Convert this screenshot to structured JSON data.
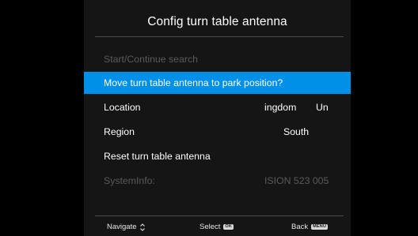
{
  "dialog": {
    "title": "Config turn table antenna"
  },
  "menu": {
    "items": [
      {
        "label": "Start/Continue search",
        "state": "disabled"
      },
      {
        "label": "Move turn table antenna to park position?",
        "state": "selected"
      },
      {
        "label": "Location",
        "value_a": "ingdom",
        "value_b": "Un",
        "state": "normal"
      },
      {
        "label": "Region",
        "value_a": "South",
        "state": "normal"
      },
      {
        "label": "Reset turn table antenna",
        "state": "normal"
      },
      {
        "label": "SystemInfo:",
        "value_a": "ISION 523 005",
        "state": "disabled"
      }
    ]
  },
  "footer": {
    "navigate_label": "Navigate",
    "navigate_icon": "up-down-arrows-icon",
    "select_label": "Select",
    "select_key": "OK",
    "back_label": "Back",
    "back_key": "MENU"
  },
  "colors": {
    "background": "#000000",
    "panel": "#151515",
    "highlight": "#0090e8",
    "disabled_text": "#5a5a5a"
  }
}
